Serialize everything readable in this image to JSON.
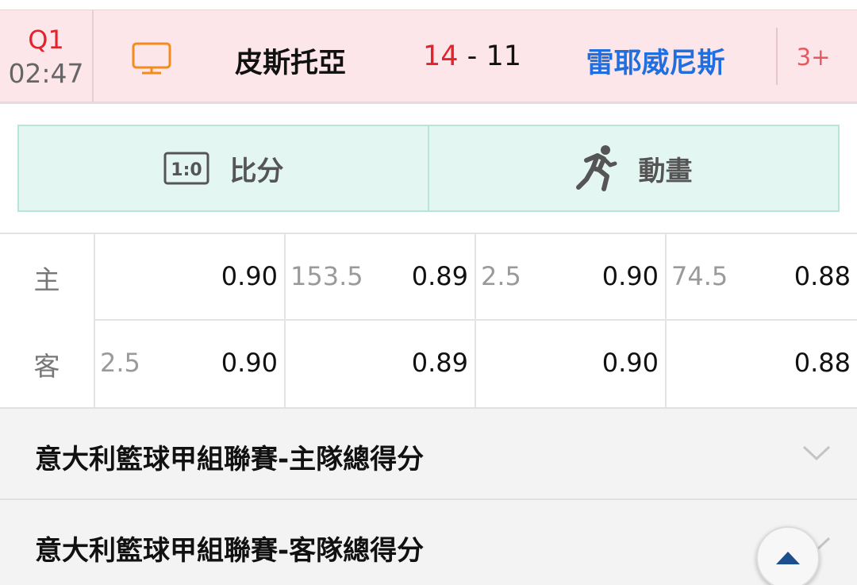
{
  "match": {
    "period": "Q1",
    "clock": "02:47",
    "home_team": "皮斯托亞",
    "home_score": "14",
    "score_sep": " - ",
    "away_score": "11",
    "away_team": "雷耶威尼斯",
    "more": "3+"
  },
  "tabs": [
    {
      "label": "比分",
      "icon": "scoreboard-icon",
      "icon_text": "1:0"
    },
    {
      "label": "動畫",
      "icon": "runner-icon"
    }
  ],
  "odds": {
    "rows": [
      {
        "label": "主",
        "cells": [
          {
            "line": "",
            "price": "0.90"
          },
          {
            "line": "153.5",
            "price": "0.89"
          },
          {
            "line": "2.5",
            "price": "0.90"
          },
          {
            "line": "74.5",
            "price": "0.88"
          }
        ]
      },
      {
        "label": "客",
        "cells": [
          {
            "line": "2.5",
            "price": "0.90"
          },
          {
            "line": "",
            "price": "0.89"
          },
          {
            "line": "",
            "price": "0.90"
          },
          {
            "line": "",
            "price": "0.88"
          }
        ]
      }
    ]
  },
  "markets": [
    {
      "title": "意大利籃球甲組聯賽-主隊總得分"
    },
    {
      "title": "意大利籃球甲組聯賽-客隊總得分"
    }
  ],
  "colors": {
    "header_bg": "#fde6ea",
    "live_red": "#e3222b",
    "away_blue": "#1f6fe0",
    "tab_bg": "#e4f6f1",
    "scroll_arrow": "#1d4f8f"
  }
}
